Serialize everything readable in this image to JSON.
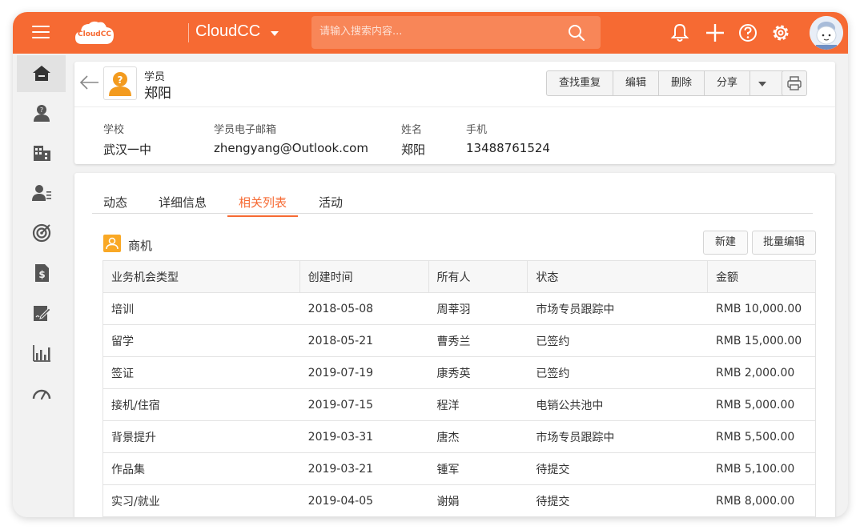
{
  "topbar": {
    "logo_text": "CloudCC",
    "app_name": "CloudCC",
    "search_placeholder": "请输入搜索内容...",
    "icons": [
      "hamburger-icon",
      "search-icon",
      "bell-icon",
      "plus-icon",
      "help-icon",
      "gear-icon",
      "avatar"
    ],
    "accent_color": "#f66a33"
  },
  "sidebar": {
    "items": [
      {
        "icon": "home-icon",
        "active": true
      },
      {
        "icon": "student-icon"
      },
      {
        "icon": "building-icon"
      },
      {
        "icon": "contact-list-icon"
      },
      {
        "icon": "target-icon"
      },
      {
        "icon": "invoice-icon"
      },
      {
        "icon": "edit-document-icon"
      },
      {
        "icon": "bar-chart-icon"
      },
      {
        "icon": "dashboard-gauge-icon"
      }
    ]
  },
  "record": {
    "type": "学员",
    "name": "郑阳",
    "actions": [
      "查找重复",
      "编辑",
      "删除",
      "分享"
    ],
    "fields": [
      {
        "label": "学校",
        "value": "武汉一中"
      },
      {
        "label": "学员电子邮箱",
        "value": "zhengyang@Outlook.com"
      },
      {
        "label": "姓名",
        "value": "郑阳"
      },
      {
        "label": "手机",
        "value": "13488761524"
      }
    ]
  },
  "tabs": [
    {
      "label": "动态"
    },
    {
      "label": "详细信息"
    },
    {
      "label": "相关列表",
      "active": true
    },
    {
      "label": "活动"
    }
  ],
  "related": {
    "title": "商机",
    "new_label": "新建",
    "bulk_edit_label": "批量编辑",
    "columns": [
      "业务机会类型",
      "创建时间",
      "所有人",
      "状态",
      "金额"
    ],
    "rows": [
      [
        "培训",
        "2018-05-08",
        "周莘羽",
        "市场专员跟踪中",
        "RMB 10,000.00"
      ],
      [
        "留学",
        "2018-05-21",
        "曹秀兰",
        "已签约",
        "RMB 15,000.00"
      ],
      [
        "签证",
        "2019-07-19",
        "康秀英",
        "已签约",
        "RMB 2,000.00"
      ],
      [
        "接机/住宿",
        "2019-07-15",
        "程洋",
        "电销公共池中",
        "RMB 5,000.00"
      ],
      [
        "背景提升",
        "2019-03-31",
        "唐杰",
        "市场专员跟踪中",
        "RMB 5,500.00"
      ],
      [
        "作品集",
        "2019-03-21",
        "锺军",
        "待提交",
        "RMB 5,100.00"
      ],
      [
        "实习/就业",
        "2019-04-05",
        "谢娟",
        "待提交",
        "RMB 8,000.00"
      ]
    ]
  }
}
